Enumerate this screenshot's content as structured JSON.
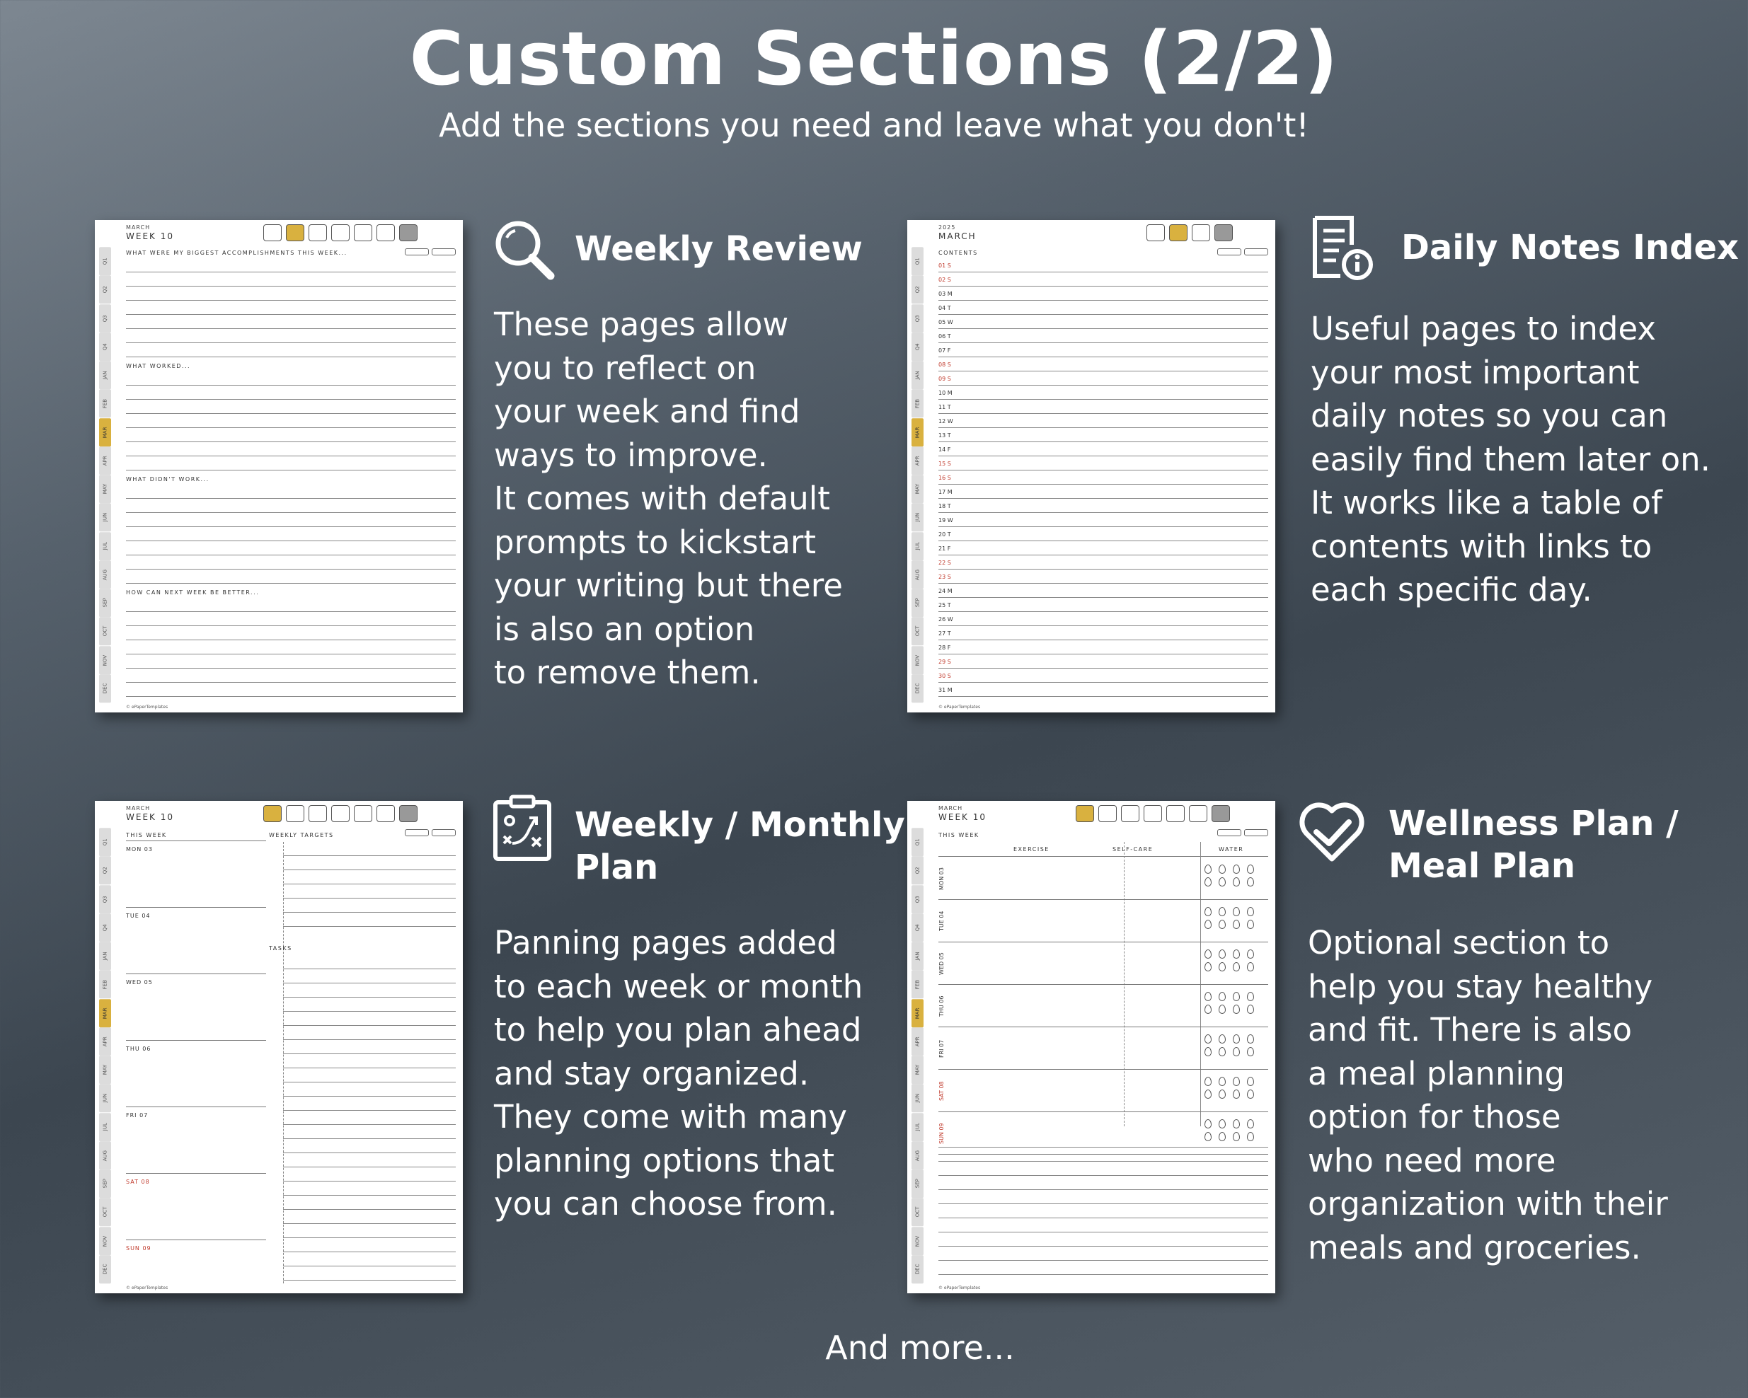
{
  "header": {
    "title": "Custom Sections (2/2)",
    "subtitle": "Add the sections you need and leave what you don't!"
  },
  "footer_text": "And more...",
  "sections": [
    {
      "title": "Weekly Review",
      "text": "These pages allow\nyou to reflect on\nyour week and find\nways to improve.\nIt comes with default\nprompts to kickstart\nyour writing but there\nis also an option\nto remove them.",
      "icon": "magnifier-icon"
    },
    {
      "title": "Daily Notes Index",
      "text": "Useful pages to index\nyour most important\ndaily notes so you can\neasily find them later on.\nIt works like a table of\ncontents with links to\neach specific day.",
      "icon": "document-info-icon"
    },
    {
      "title": "Weekly / Monthly\nPlan",
      "text": "Panning pages added\nto each week or month\nto help you plan ahead\nand stay organized.\nThey come with many\nplanning options that\nyou can choose from.",
      "icon": "clipboard-strategy-icon"
    },
    {
      "title": "Wellness Plan /\nMeal Plan",
      "text": "Optional section to\nhelp you stay healthy\nand fit. There is also\na meal planning\noption for those\nwho need more\norganization with their\nmeals and groceries.",
      "icon": "heart-check-icon"
    }
  ],
  "planner": {
    "tabs": [
      "Q1",
      "Q2",
      "Q3",
      "Q4",
      "JAN",
      "FEB",
      "MAR",
      "APR",
      "MAY",
      "JUN",
      "JUL",
      "AUG",
      "SEP",
      "OCT",
      "NOV",
      "DEC"
    ],
    "active_tab": "MAR",
    "copyright": "© ePaperTemplates",
    "accent": "#d9b13f",
    "weekend_color": "#c0392b"
  },
  "page_review": {
    "month": "MARCH",
    "week": "WEEK 10",
    "prompts": [
      "WHAT WERE MY BIGGEST ACCOMPLISHMENTS THIS WEEK...",
      "WHAT WORKED...",
      "WHAT DIDN'T WORK...",
      "HOW CAN NEXT WEEK BE BETTER..."
    ]
  },
  "page_index": {
    "year": "2025",
    "month": "MARCH",
    "heading": "CONTENTS",
    "rows": [
      "01 S",
      "02 S",
      "03 M",
      "04 T",
      "05 W",
      "06 T",
      "07 F",
      "08 S",
      "09 S",
      "10 M",
      "11 T",
      "12 W",
      "13 T",
      "14 F",
      "15 S",
      "16 S",
      "17 M",
      "18 T",
      "19 W",
      "20 T",
      "21 F",
      "22 S",
      "23 S",
      "24 M",
      "25 T",
      "26 W",
      "27 T",
      "28 F",
      "29 S",
      "30 S",
      "31 M"
    ],
    "weekend_rows": [
      "01 S",
      "02 S",
      "08 S",
      "09 S",
      "15 S",
      "16 S",
      "22 S",
      "23 S",
      "29 S",
      "30 S"
    ]
  },
  "page_plan": {
    "month": "MARCH",
    "week": "WEEK 10",
    "this_week": "THIS WEEK",
    "weekly_targets": "WEEKLY TARGETS",
    "tasks": "TASKS",
    "days": [
      "MON 03",
      "TUE 04",
      "WED 05",
      "THU 06",
      "FRI 07",
      "SAT 08",
      "SUN 09"
    ]
  },
  "page_wellness": {
    "month": "MARCH",
    "week": "WEEK 10",
    "this_week": "THIS WEEK",
    "columns": [
      "EXERCISE",
      "SELF-CARE",
      "WATER"
    ],
    "days": [
      "MON 03",
      "TUE 04",
      "WED 05",
      "THU 06",
      "FRI 07",
      "SAT 08",
      "SUN 09"
    ]
  }
}
